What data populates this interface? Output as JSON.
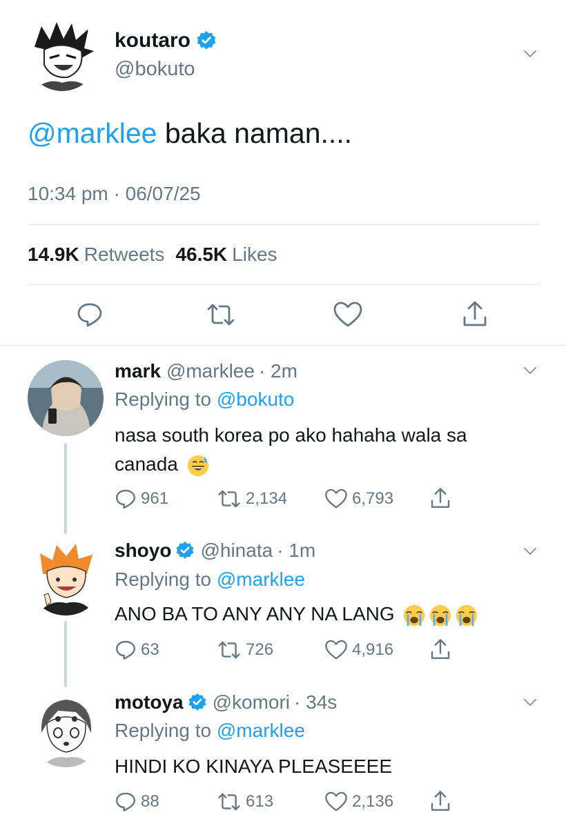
{
  "main_tweet": {
    "name": "koutaro",
    "handle": "@bokuto",
    "mention": "@marklee",
    "text": " baka naman....",
    "time": "10:34 pm · 06/07/25",
    "retweets_count": "14.9K",
    "retweets_label": "Retweets",
    "likes_count": "46.5K",
    "likes_label": "Likes"
  },
  "replies": [
    {
      "name": "mark",
      "handle": "@marklee",
      "time": "· 2m",
      "replying_prefix": "Replying to ",
      "replying_to": "@bokuto",
      "text_line1": "nasa south korea po ako hahaha wala sa",
      "text_line2": "canada",
      "emoji": [
        "grinning-sweat-emoji"
      ],
      "reply_count": "961",
      "retweet_count": "2,134",
      "like_count": "6,793"
    },
    {
      "name": "shoyo",
      "handle": "@hinata",
      "time": "· 1m",
      "replying_prefix": "Replying to ",
      "replying_to": "@marklee",
      "text_line1": "ANO BA TO ANY ANY NA LANG",
      "emoji": [
        "loudly-crying-emoji",
        "loudly-crying-emoji",
        "loudly-crying-emoji"
      ],
      "reply_count": "63",
      "retweet_count": "726",
      "like_count": "4,916"
    },
    {
      "name": "motoya",
      "handle": "@komori",
      "time": "· 34s",
      "replying_prefix": "Replying to ",
      "replying_to": "@marklee",
      "text_line1": "HINDI KO KINAYA PLEASEEEE",
      "reply_count": "88",
      "retweet_count": "613",
      "like_count": "2,136"
    }
  ],
  "colors": {
    "accent": "#1da1f2",
    "secondary_text": "#657786",
    "divider": "#e1e8ed"
  }
}
